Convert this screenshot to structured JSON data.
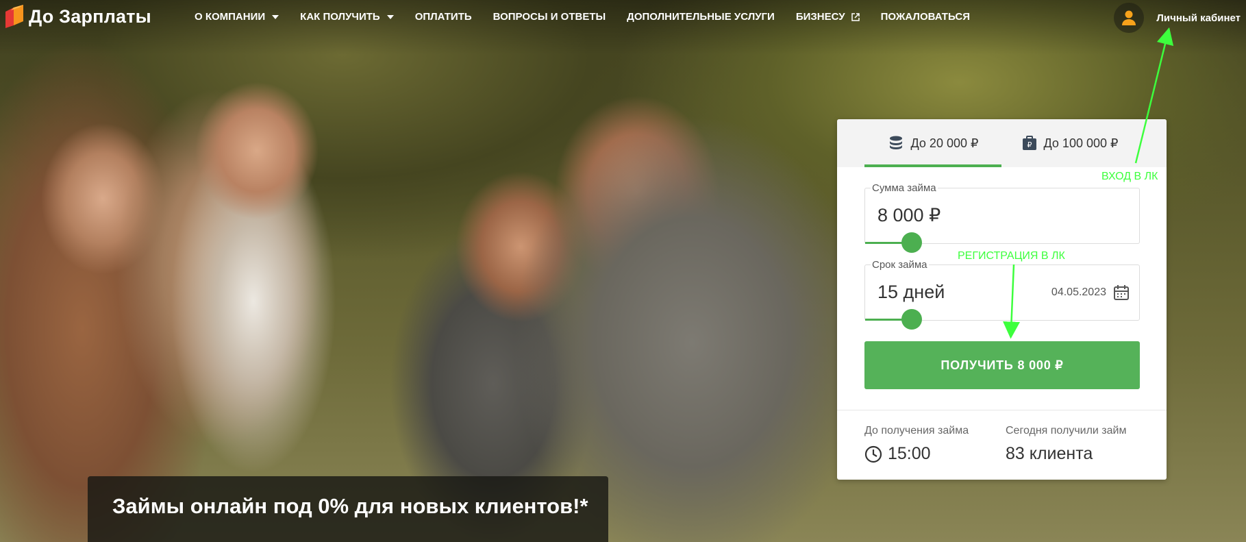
{
  "brand": {
    "name": "До Зарплаты",
    "logo_colors": [
      "#f7941d",
      "#e53935"
    ]
  },
  "nav": {
    "items": [
      {
        "label": "О КОМПАНИИ",
        "has_dropdown": true
      },
      {
        "label": "КАК ПОЛУЧИТЬ",
        "has_dropdown": true
      },
      {
        "label": "ОПЛАТИТЬ",
        "has_dropdown": false
      },
      {
        "label": "ВОПРОСЫ И ОТВЕТЫ",
        "has_dropdown": false
      },
      {
        "label": "ДОПОЛНИТЕЛЬНЫЕ УСЛУГИ",
        "has_dropdown": false
      },
      {
        "label": "БИЗНЕСУ",
        "has_external": true
      },
      {
        "label": "ПОЖАЛОВАТЬСЯ",
        "has_dropdown": false
      }
    ]
  },
  "account": {
    "label": "Личный кабинет",
    "icon": "user-icon",
    "icon_color": "#f7a21b"
  },
  "widget": {
    "tabs": [
      {
        "label": "До 20 000 ₽",
        "icon": "coins-icon",
        "active": true
      },
      {
        "label": "До 100 000 ₽",
        "icon": "briefcase-ruble-icon",
        "active": false
      }
    ],
    "amount": {
      "label": "Сумма займа",
      "value": "8 000 ₽",
      "slider_fraction": 0.17
    },
    "term": {
      "label": "Срок займа",
      "value": "15 дней",
      "date": "04.05.2023",
      "slider_fraction": 0.17
    },
    "cta_label": "ПОЛУЧИТЬ 8 000 ₽",
    "accent_color": "#4caf50",
    "stats": [
      {
        "label": "До получения займа",
        "value": "15:00",
        "icon": "clock-icon"
      },
      {
        "label": "Сегодня получили займ",
        "value": "83 клиента"
      }
    ]
  },
  "banner": {
    "text": "Займы онлайн под 0% для новых клиентов!*"
  },
  "annotations": {
    "login": "ВХОД В ЛК",
    "register": "РЕГИСТРАЦИЯ В ЛК",
    "color": "#3dff3d"
  }
}
